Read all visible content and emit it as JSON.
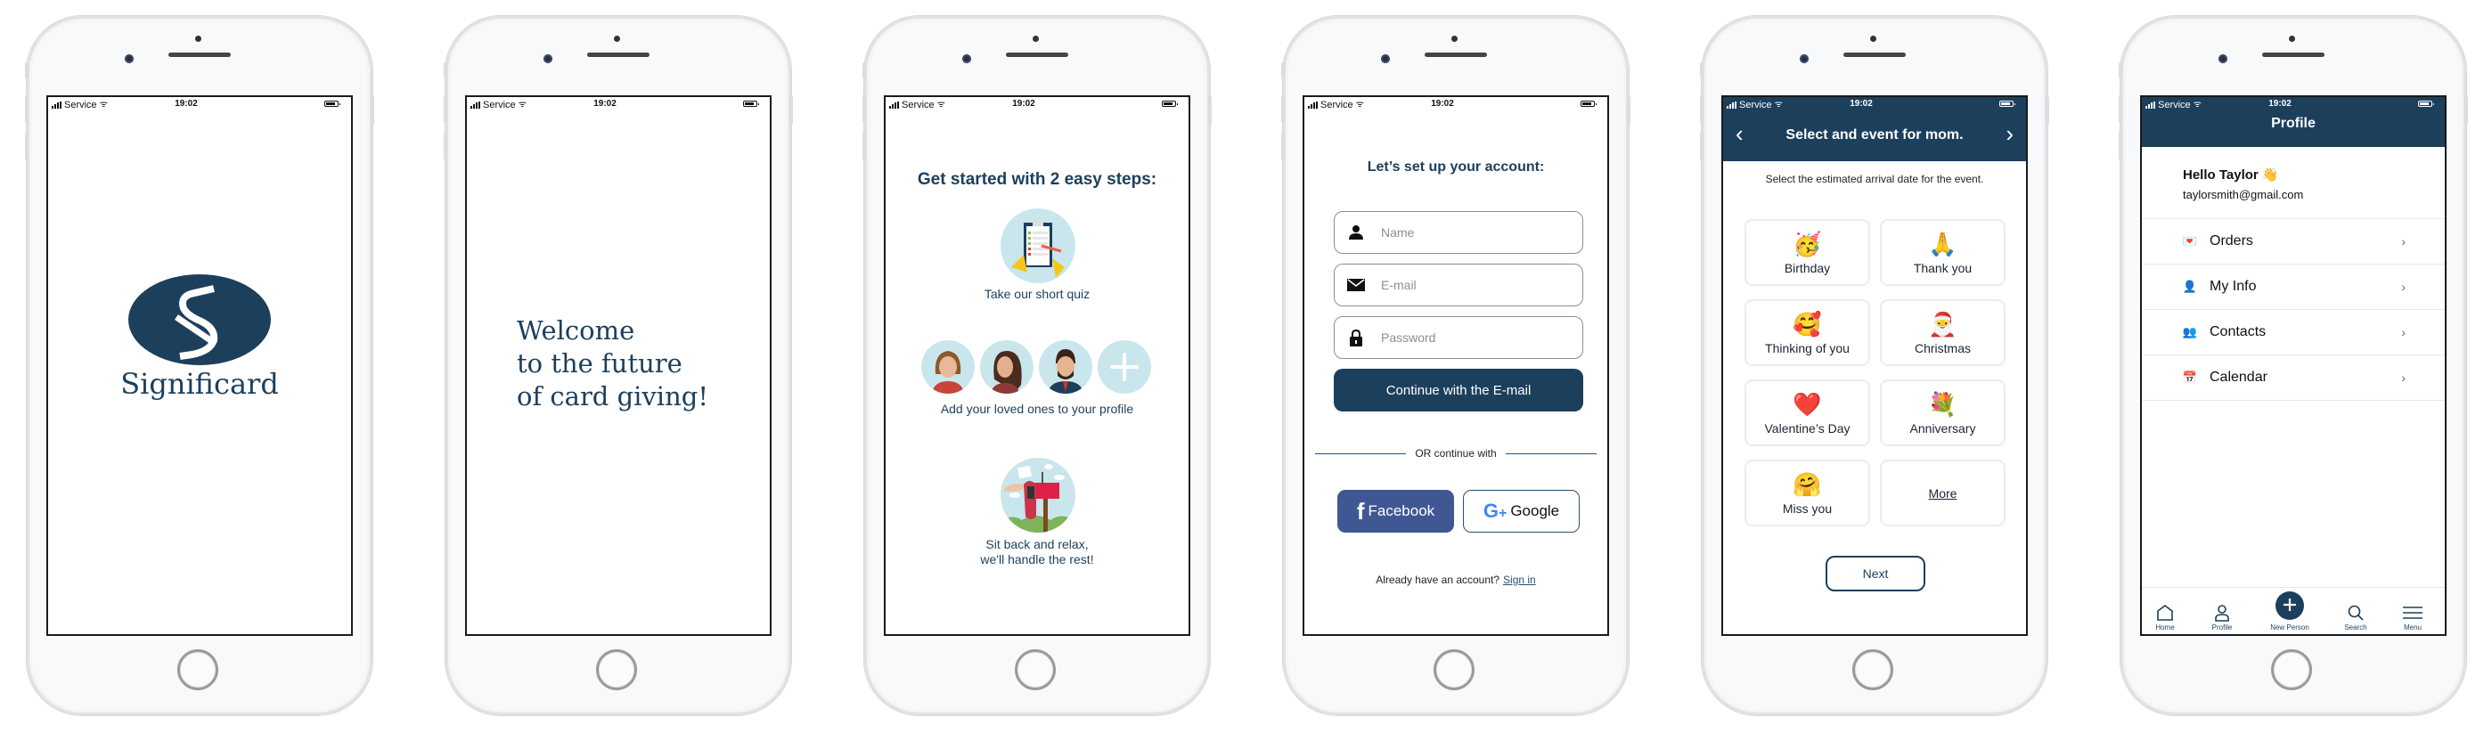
{
  "status_bar": {
    "carrier": "Service",
    "time": "19:02"
  },
  "screens": {
    "splash": {
      "brand": "Significard",
      "logo_letter": "S"
    },
    "welcome": {
      "lines": [
        "Welcome",
        "to the future",
        "of card giving!"
      ]
    },
    "get_started": {
      "title": "Get started with 2 easy steps:",
      "steps": [
        {
          "icon": "quiz-clipboard-icon",
          "caption": "Take our short quiz"
        },
        {
          "icon": "loved-ones-avatars",
          "caption": "Add your loved ones to your profile"
        },
        {
          "icon": "mailbox-icon",
          "caption_lines": [
            "Sit back and relax,",
            "we'll handle the rest!"
          ]
        }
      ]
    },
    "account": {
      "title": "Let’s set up your account:",
      "fields": [
        {
          "icon": "person-icon",
          "placeholder": "Name",
          "value": ""
        },
        {
          "icon": "mail-icon",
          "placeholder": "E-mail",
          "value": ""
        },
        {
          "icon": "lock-icon",
          "placeholder": "Password",
          "value": ""
        }
      ],
      "continue_label": "Continue with the E-mail",
      "divider_label": "OR continue with",
      "facebook_label": "Facebook",
      "google_label": "Google",
      "signin_prompt": "Already have an account?",
      "signin_link": "Sign in"
    },
    "event": {
      "title": "Select and event for mom.",
      "subtitle": "Select the estimated arrival date for the event.",
      "options": [
        {
          "emoji": "🥳",
          "label": "Birthday"
        },
        {
          "emoji": "🙏",
          "label": "Thank you"
        },
        {
          "emoji": "🥰",
          "label": "Thinking of you"
        },
        {
          "emoji": "🎅",
          "label": "Christmas"
        },
        {
          "emoji": "❤️",
          "label": "Valentine’s Day"
        },
        {
          "emoji": "💐",
          "label": "Anniversary"
        },
        {
          "emoji": "🤗",
          "label": "Miss you"
        },
        {
          "emoji": "",
          "label": "More"
        }
      ],
      "next_label": "Next"
    },
    "profile": {
      "title": "Profile",
      "greeting": "Hello Taylor 👋",
      "email": "taylorsmith@gmail.com",
      "menu": [
        {
          "emoji": "💌",
          "label": "Orders"
        },
        {
          "emoji": "👤",
          "label": "My Info"
        },
        {
          "emoji": "👥",
          "label": "Contacts"
        },
        {
          "emoji": "📅",
          "label": "Calendar"
        }
      ],
      "tabs": [
        {
          "icon": "home-icon",
          "label": "Home"
        },
        {
          "icon": "profile-icon",
          "label": "Profile"
        },
        {
          "icon": "plus-icon",
          "label": "New Person"
        },
        {
          "icon": "search-icon",
          "label": "Search"
        },
        {
          "icon": "menu-icon",
          "label": "Menu"
        }
      ]
    }
  },
  "colors": {
    "brand_navy": "#1c3f5c",
    "facebook_blue": "#3f5893",
    "illustration_bg": "#c9e6ec"
  }
}
